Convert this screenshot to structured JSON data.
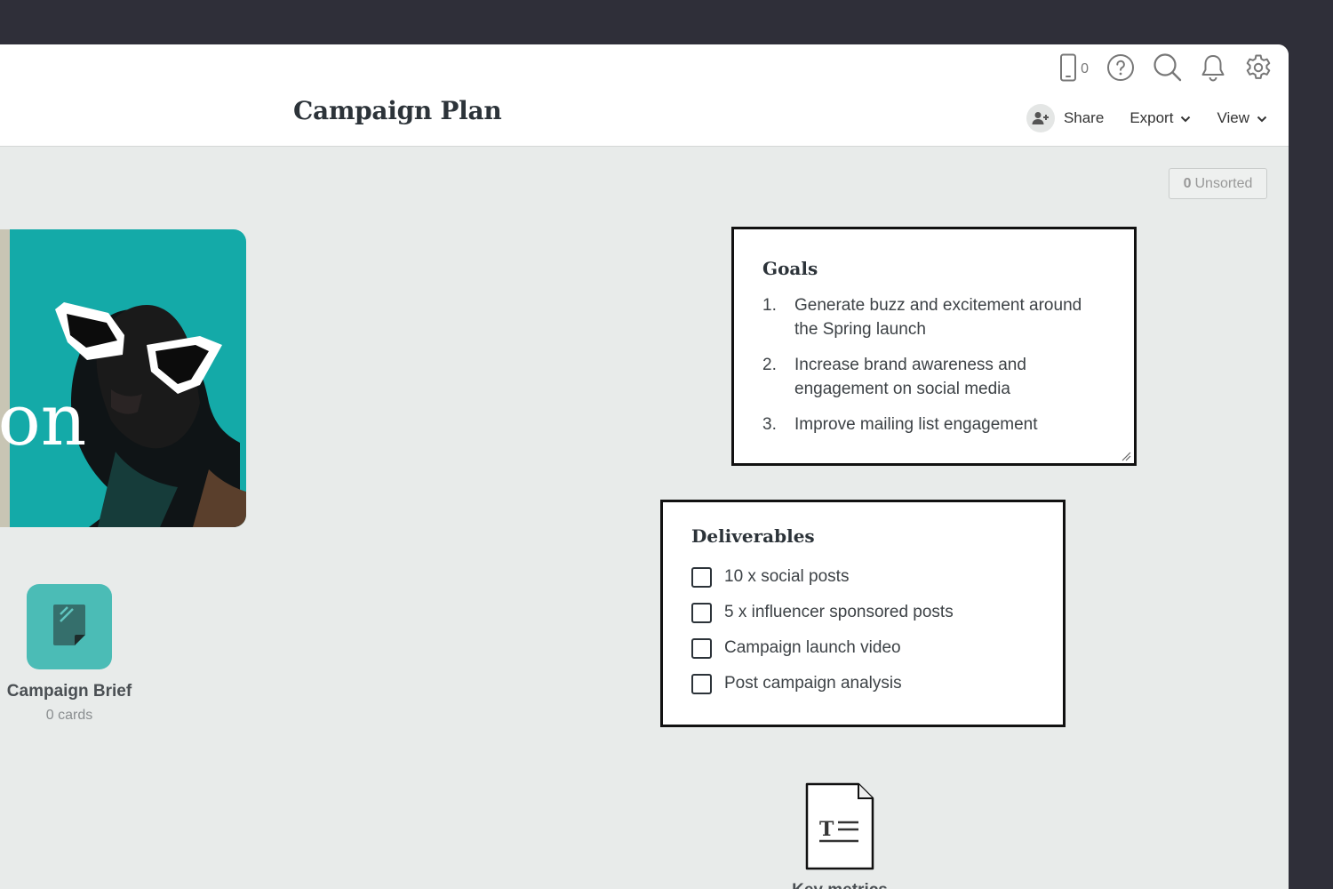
{
  "header": {
    "title": "Campaign Plan",
    "device_count": "0",
    "share_label": "Share",
    "export_label": "Export",
    "view_label": "View"
  },
  "canvas": {
    "unsorted_count": "0",
    "unsorted_label": "Unsorted",
    "image_card": {
      "overlay_text": "ion"
    },
    "board": {
      "title": "Campaign Brief",
      "subtitle": "0 cards",
      "color": "#4bbcb6"
    },
    "goals": {
      "heading": "Goals",
      "items": [
        {
          "num": "1.",
          "text": "Generate buzz and excitement around the Spring launch"
        },
        {
          "num": "2.",
          "text": "Increase brand awareness and engagement on social media"
        },
        {
          "num": "3.",
          "text": "Improve mailing list engagement"
        }
      ]
    },
    "deliverables": {
      "heading": "Deliverables",
      "items": [
        {
          "label": "10 x social posts",
          "checked": false
        },
        {
          "label": "5 x influencer sponsored posts",
          "checked": false
        },
        {
          "label": "Campaign launch video",
          "checked": false
        },
        {
          "label": "Post campaign analysis",
          "checked": false
        }
      ]
    },
    "document": {
      "title": "Key metrics"
    }
  },
  "colors": {
    "background": "#2f2f39",
    "canvas": "#e8ebea",
    "accent_teal": "#4bbcb6",
    "photo_teal": "#14aaa8"
  },
  "icons": [
    "device-icon",
    "help-icon",
    "search-icon",
    "bell-icon",
    "gear-icon",
    "add-user-icon",
    "chevron-down-icon",
    "note-icon",
    "text-document-icon",
    "resize-handle-icon"
  ]
}
